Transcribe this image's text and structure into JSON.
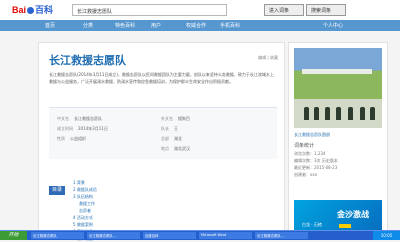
{
  "header": {
    "logo_baidu": "Bai",
    "logo_paw": "度",
    "logo_baike": "百科",
    "search_value": "长江救援志愿队",
    "search_buttons": [
      "进入词条",
      "搜索词条"
    ]
  },
  "nav": [
    "首页",
    "分类",
    "特色百科",
    "用户",
    "权威合作",
    "手机百科",
    "个人中心"
  ],
  "article": {
    "title": "长江救援志愿队",
    "actions": "编辑 | 收藏",
    "summary": "长江救援志愿队(2014年3月11日成立)，救援志愿队以民间救援团队为主要力量，创队以来坚持义务救援，致力于长江流域水上救援与公益服务，广泛开展溺水救援、防溺水宣传和应急救援培训，为保护群众生命安全作出积极贡献。",
    "info": [
      [
        "中文名",
        "长江救援志愿队",
        "外文名",
        "搜狗百"
      ],
      [
        "成立时间",
        "2014年3月11日",
        "队长",
        "王"
      ],
      [
        "性质",
        "公益组织",
        "总部",
        "湖北"
      ],
      [
        "",
        "",
        "地点",
        "湖北武汉"
      ]
    ],
    "toc_label": "目录",
    "toc": [
      "1 背景",
      "2 救援队成员",
      "3 队伍结构",
      "救援工作",
      "志愿者",
      "4 活动方式",
      "5 救援案例",
      "6 荣誉称号",
      "7 规章制度",
      "8 帮助本队伍队伍发展"
    ]
  },
  "side": {
    "caption": "长江救援志愿队图册",
    "stat_title": "词条统计",
    "stats": [
      "浏览次数：1,234",
      "编辑次数：3次 历史版本",
      "最近更新：2015-08-23",
      "创建者：xxx"
    ],
    "banner_big": "金沙激战",
    "banner_small": "白龙 · 石棺"
  },
  "taskbar": {
    "start": "开始",
    "tasks": [
      "长江救援志愿队",
      "长江救援志愿队...",
      "百度百科",
      "Microsoft Word",
      "长江救援志愿队..."
    ],
    "tray": "10:05"
  }
}
